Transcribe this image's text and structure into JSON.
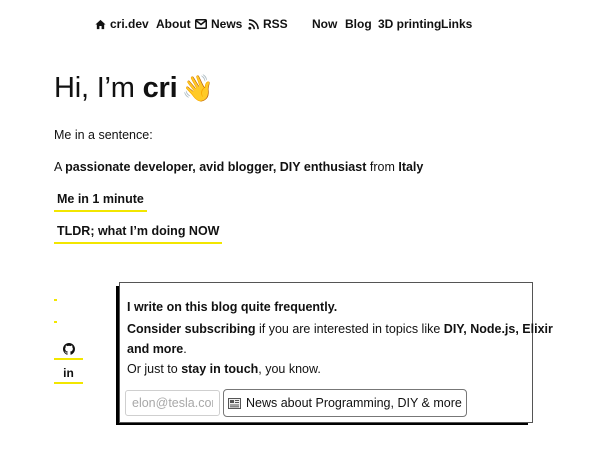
{
  "nav": {
    "home": "cri.dev",
    "about": "About",
    "news": "News",
    "rss": "RSS",
    "now": "Now",
    "blog": "Blog",
    "printing": "3D printing",
    "links": "Links",
    "icons": {
      "home": "home-icon",
      "news": "mail-icon",
      "rss": "rss-icon"
    }
  },
  "hero": {
    "greeting": "Hi, I’m ",
    "name": "cri",
    "emoji": "👋"
  },
  "intro": "Me in a sentence:",
  "sentence": {
    "prefix": "A ",
    "bold1": "passionate developer, avid blogger, DIY enthusiast",
    "middle": " from ",
    "bold2": "Italy"
  },
  "links": {
    "minute": "Me in 1 minute",
    "tldr": "TLDR; what I’m doing NOW"
  },
  "social": {
    "github_icon": "github-icon",
    "linkedin_label": "in"
  },
  "subscribe": {
    "line1": "I write on this blog quite frequently.",
    "line2_bold": "Consider subscribing",
    "line2_rest": " if you are interested in topics like ",
    "line2_topics": "DIY, Node.js, Elixir",
    "line3_bold": "and more",
    "line3_rest": ".",
    "line4_prefix": "Or just to ",
    "line4_bold": "stay in touch",
    "line4_rest": ", you know.",
    "email_placeholder": "elon@tesla.com",
    "button_label": "News about Programming, DIY & more",
    "button_icon": "newspaper-icon"
  },
  "colors": {
    "accent": "#f2e600",
    "text": "#111111",
    "shadow": "#000000"
  }
}
